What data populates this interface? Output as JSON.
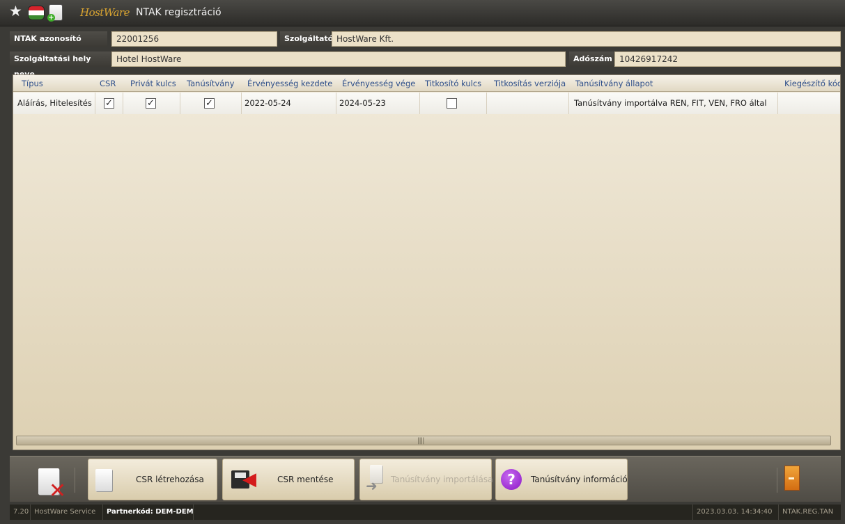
{
  "window": {
    "title": "NTAK regisztráció",
    "logo_text": "HostWare"
  },
  "header": {
    "ntak_label": "NTAK azonosító",
    "ntak_value": "22001256",
    "provider_label": "Szolgáltató",
    "provider_value": "HostWare Kft.",
    "place_label": "Szolgáltatási hely neve",
    "place_value": "Hotel HostWare",
    "tax_label": "Adószám",
    "tax_value": "10426917242"
  },
  "grid": {
    "columns": [
      "Típus",
      "CSR",
      "Privát kulcs",
      "Tanúsítvány",
      "Érvényesség kezdete",
      "Érvényesség vége",
      "Titkosító kulcs",
      "Titkosítás verziója",
      "Tanúsítvány állapot",
      "Kiegészítő kód"
    ],
    "rows": [
      {
        "tipus": "Aláírás, Hitelesítés",
        "csr": true,
        "privat_kulcs": true,
        "tanusitvany": true,
        "kezdete": "2022-05-24",
        "vege": "2024-05-23",
        "titkosito_kulcs": false,
        "verzio": "",
        "allapot": "Tanúsítvány importálva REN, FIT, VEN, FRO által",
        "kiegeszito": ""
      }
    ],
    "check_glyph": "✓"
  },
  "toolbar": {
    "create_csr": "CSR létrehozása",
    "save_csr": "CSR mentése",
    "import_cert": "Tanúsítvány importálása",
    "cert_info": "Tanúsítvány információ"
  },
  "status": {
    "version": "7.20",
    "service": "HostWare Service",
    "partner": "Partnerkód: DEM-DEM",
    "datetime": "2023.03.03. 14:34:40",
    "module": "NTAK.REG.TAN"
  },
  "colors": {
    "accent_logo": "#d9a431",
    "info_purple": "#8a15c5",
    "delete_red": "#d02020",
    "exit_orange": "#e58a22",
    "header_text_blue": "#2e4f8a"
  }
}
